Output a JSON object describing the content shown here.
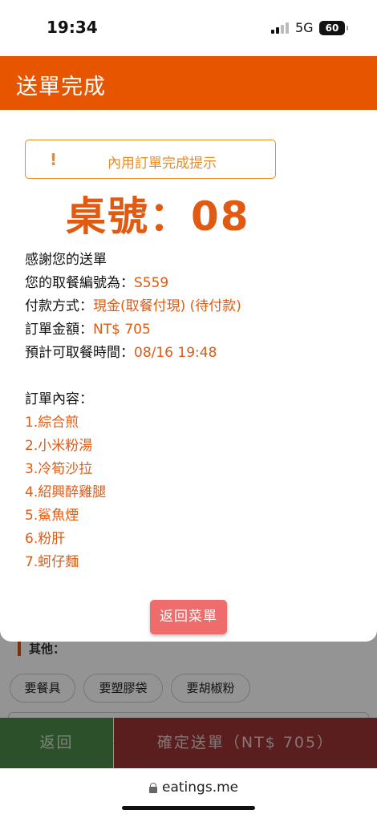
{
  "status_bar": {
    "time": "19:34",
    "network": "5G",
    "battery": "60"
  },
  "background": {
    "section_title": "其他：",
    "chips": [
      "要餐具",
      "要塑膠袋",
      "要胡椒粉"
    ],
    "back_label": "返回",
    "confirm_label": "確定送單（NT$ 705）"
  },
  "modal": {
    "title": "送單完成",
    "alert_icon": "!",
    "alert_text": "內用訂單完成提示",
    "table_number": "桌號：08",
    "thanks": "感謝您的送單",
    "pickup_label": "您的取餐編號為：",
    "pickup_value": "S559",
    "payment_label": "付款方式：",
    "payment_value": "現金(取餐付現) (待付款)",
    "amount_label": "訂單金額：",
    "amount_value": "NT$ 705",
    "time_label": "預計可取餐時間：",
    "time_value": "08/16 19:48",
    "order_label": "訂單內容：",
    "items": [
      "1.綜合煎",
      "2.小米粉湯",
      "3.冷筍沙拉",
      "4.紹興醉雞腿",
      "5.鯊魚煙",
      "6.粉肝",
      "7.蚵仔麵"
    ],
    "menu_button": "返回菜單"
  },
  "browser": {
    "url": "eatings.me"
  },
  "colors": {
    "header": "#e85500",
    "accent": "#e05a12",
    "alert": "#ee8a22",
    "menu_button": "#ef6c6c"
  },
  "icons": {
    "alert": "exclamation-icon",
    "lock": "lock-icon",
    "signal": "signal-icon"
  }
}
